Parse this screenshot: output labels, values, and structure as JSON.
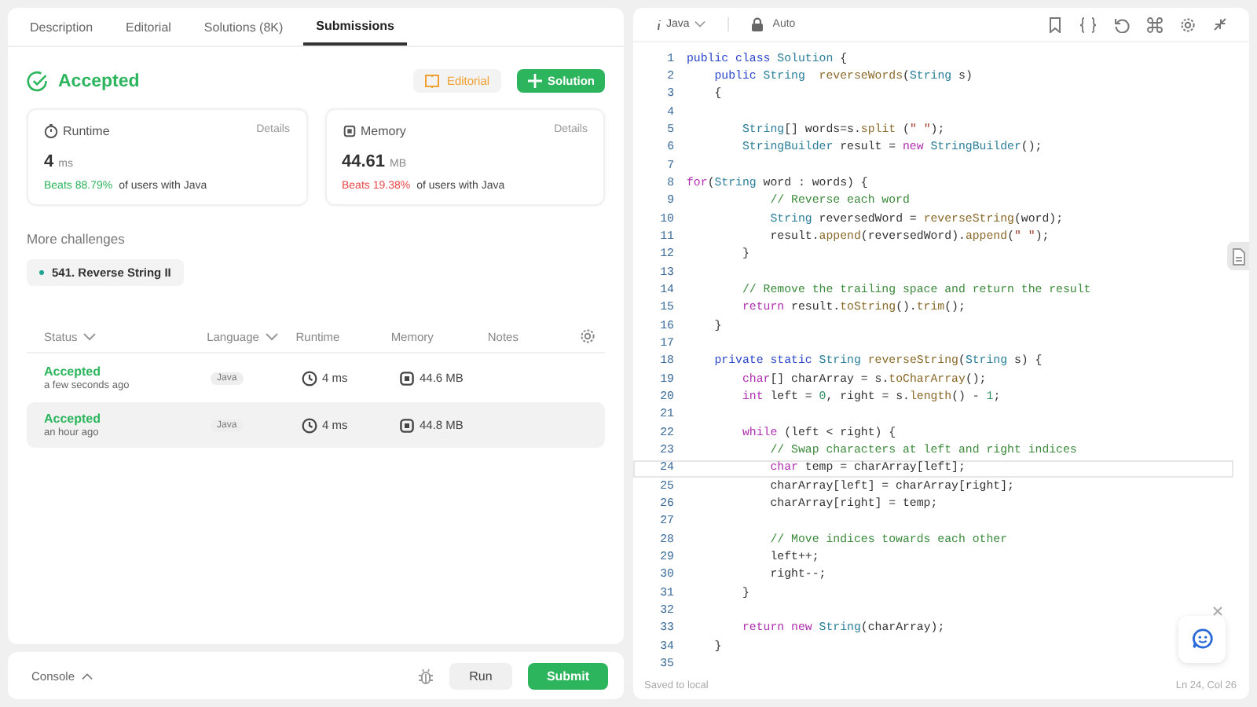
{
  "tabs": [
    {
      "label": "Description",
      "selected": false
    },
    {
      "label": "Editorial",
      "selected": false
    },
    {
      "label": "Solutions (8K)",
      "selected": false
    },
    {
      "label": "Submissions",
      "selected": true
    }
  ],
  "result": {
    "status": "Accepted",
    "editorial_button": "Editorial",
    "solution_button": "Solution"
  },
  "stats": [
    {
      "kind": "runtime",
      "title": "Runtime",
      "details": "Details",
      "value": "4",
      "unit": "ms",
      "beats": "Beats 88.79%",
      "beats_good": true,
      "suffix": "of users with Java"
    },
    {
      "kind": "memory",
      "title": "Memory",
      "details": "Details",
      "value": "44.61",
      "unit": "MB",
      "beats": "Beats 19.38%",
      "beats_good": false,
      "suffix": "of users with Java"
    }
  ],
  "more_challenges": {
    "title": "More challenges",
    "items": [
      {
        "label": "541. Reverse String II",
        "color": "#1fa392"
      }
    ]
  },
  "submissions": {
    "columns": [
      "Status",
      "Language",
      "Runtime",
      "Memory",
      "Notes"
    ],
    "rows": [
      {
        "status": "Accepted",
        "time": "a few seconds ago",
        "language": "Java",
        "runtime": "4 ms",
        "memory": "44.6 MB",
        "selected": false
      },
      {
        "status": "Accepted",
        "time": "an hour ago",
        "language": "Java",
        "runtime": "4 ms",
        "memory": "44.8 MB",
        "selected": true
      }
    ]
  },
  "console_bar": {
    "console": "Console",
    "run": "Run",
    "submit": "Submit"
  },
  "editor": {
    "language": "Java",
    "mode": "Auto",
    "lines": [
      {
        "number": "1",
        "current": false,
        "tokens": [
          {
            "kind": "kw",
            "text": "public class "
          },
          {
            "kind": "type",
            "text": "Solution"
          },
          {
            "kind": "pl",
            "text": " {"
          }
        ]
      },
      {
        "number": "2",
        "current": false,
        "tokens": [
          {
            "kind": "kw",
            "text": "    public "
          },
          {
            "kind": "type",
            "text": "String  "
          },
          {
            "kind": "fn",
            "text": "reverseWords"
          },
          {
            "kind": "pl",
            "text": "("
          },
          {
            "kind": "type",
            "text": "String"
          },
          {
            "kind": "pl",
            "text": " s)"
          }
        ]
      },
      {
        "number": "3",
        "current": false,
        "tokens": [
          {
            "kind": "pl",
            "text": "    {"
          }
        ]
      },
      {
        "number": "4",
        "current": false
      },
      {
        "number": "5",
        "current": false,
        "tokens": [
          {
            "kind": "type",
            "text": "        String"
          },
          {
            "kind": "pl",
            "text": "[] words=s."
          },
          {
            "kind": "fn",
            "text": "split"
          },
          {
            "kind": "pl",
            "text": " ("
          },
          {
            "kind": "str",
            "text": "\" \""
          },
          {
            "kind": "pl",
            "text": ");"
          }
        ]
      },
      {
        "number": "6",
        "current": false,
        "tokens": [
          {
            "kind": "type",
            "text": "        StringBuilder"
          },
          {
            "kind": "pl",
            "text": " result = "
          },
          {
            "kind": "ctl",
            "text": "new "
          },
          {
            "kind": "type",
            "text": "StringBuilder"
          },
          {
            "kind": "pl",
            "text": "();"
          }
        ]
      },
      {
        "number": "7",
        "current": false
      },
      {
        "number": "8",
        "current": false,
        "tokens": [
          {
            "kind": "ctl",
            "text": "for"
          },
          {
            "kind": "pl",
            "text": "("
          },
          {
            "kind": "type",
            "text": "String"
          },
          {
            "kind": "pl",
            "text": " word : words) {"
          }
        ]
      },
      {
        "number": "9",
        "current": false,
        "tokens": [
          {
            "kind": "cm",
            "text": "            // Reverse each word"
          }
        ]
      },
      {
        "number": "10",
        "current": false,
        "tokens": [
          {
            "kind": "type",
            "text": "            String"
          },
          {
            "kind": "pl",
            "text": " reversedWord = "
          },
          {
            "kind": "fn",
            "text": "reverseString"
          },
          {
            "kind": "pl",
            "text": "(word);"
          }
        ]
      },
      {
        "number": "11",
        "current": false,
        "tokens": [
          {
            "kind": "pl",
            "text": "            result."
          },
          {
            "kind": "fn",
            "text": "append"
          },
          {
            "kind": "pl",
            "text": "(reversedWord)."
          },
          {
            "kind": "fn",
            "text": "append"
          },
          {
            "kind": "pl",
            "text": "("
          },
          {
            "kind": "str",
            "text": "\" \""
          },
          {
            "kind": "pl",
            "text": ");"
          }
        ]
      },
      {
        "number": "12",
        "current": false,
        "tokens": [
          {
            "kind": "pl",
            "text": "        }"
          }
        ]
      },
      {
        "number": "13",
        "current": false
      },
      {
        "number": "14",
        "current": false,
        "tokens": [
          {
            "kind": "cm",
            "text": "        // Remove the trailing space and return the result"
          }
        ]
      },
      {
        "number": "15",
        "current": false,
        "tokens": [
          {
            "kind": "ctl",
            "text": "        return "
          },
          {
            "kind": "pl",
            "text": "result."
          },
          {
            "kind": "fn",
            "text": "toString"
          },
          {
            "kind": "pl",
            "text": "()."
          },
          {
            "kind": "fn",
            "text": "trim"
          },
          {
            "kind": "pl",
            "text": "();"
          }
        ]
      },
      {
        "number": "16",
        "current": false,
        "tokens": [
          {
            "kind": "pl",
            "text": "    }"
          }
        ]
      },
      {
        "number": "17",
        "current": false
      },
      {
        "number": "18",
        "current": false,
        "tokens": [
          {
            "kind": "kw",
            "text": "    private static "
          },
          {
            "kind": "type",
            "text": "String "
          },
          {
            "kind": "fn",
            "text": "reverseString"
          },
          {
            "kind": "pl",
            "text": "("
          },
          {
            "kind": "type",
            "text": "String"
          },
          {
            "kind": "pl",
            "text": " s) {"
          }
        ]
      },
      {
        "number": "19",
        "current": false,
        "tokens": [
          {
            "kind": "ctl",
            "text": "        char"
          },
          {
            "kind": "pl",
            "text": "[] charArray = s."
          },
          {
            "kind": "fn",
            "text": "toCharArray"
          },
          {
            "kind": "pl",
            "text": "();"
          }
        ]
      },
      {
        "number": "20",
        "current": false,
        "tokens": [
          {
            "kind": "ctl",
            "text": "        int"
          },
          {
            "kind": "pl",
            "text": " left = "
          },
          {
            "kind": "num",
            "text": "0"
          },
          {
            "kind": "pl",
            "text": ", right = s."
          },
          {
            "kind": "fn",
            "text": "length"
          },
          {
            "kind": "pl",
            "text": "() - "
          },
          {
            "kind": "num",
            "text": "1"
          },
          {
            "kind": "pl",
            "text": ";"
          }
        ]
      },
      {
        "number": "21",
        "current": false
      },
      {
        "number": "22",
        "current": false,
        "tokens": [
          {
            "kind": "ctl",
            "text": "        while"
          },
          {
            "kind": "pl",
            "text": " (left < right) {"
          }
        ]
      },
      {
        "number": "23",
        "current": false,
        "tokens": [
          {
            "kind": "cm",
            "text": "            // Swap characters at left and right indices"
          }
        ]
      },
      {
        "number": "24",
        "current": true,
        "tokens": [
          {
            "kind": "ctl",
            "text": "            char"
          },
          {
            "kind": "pl",
            "text": " temp = charArray[left];"
          }
        ]
      },
      {
        "number": "25",
        "current": false,
        "tokens": [
          {
            "kind": "pl",
            "text": "            charArray[left] = charArray[right];"
          }
        ]
      },
      {
        "number": "26",
        "current": false,
        "tokens": [
          {
            "kind": "pl",
            "text": "            charArray[right] = temp;"
          }
        ]
      },
      {
        "number": "27",
        "current": false
      },
      {
        "number": "28",
        "current": false,
        "tokens": [
          {
            "kind": "cm",
            "text": "            // Move indices towards each other"
          }
        ]
      },
      {
        "number": "29",
        "current": false,
        "tokens": [
          {
            "kind": "pl",
            "text": "            left++;"
          }
        ]
      },
      {
        "number": "30",
        "current": false,
        "tokens": [
          {
            "kind": "pl",
            "text": "            right--;"
          }
        ]
      },
      {
        "number": "31",
        "current": false,
        "tokens": [
          {
            "kind": "pl",
            "text": "        }"
          }
        ]
      },
      {
        "number": "32",
        "current": false
      },
      {
        "number": "33",
        "current": false,
        "tokens": [
          {
            "kind": "ctl",
            "text": "        return new "
          },
          {
            "kind": "type",
            "text": "String"
          },
          {
            "kind": "pl",
            "text": "(charArray);"
          }
        ]
      },
      {
        "number": "34",
        "current": false,
        "tokens": [
          {
            "kind": "pl",
            "text": "    }"
          }
        ]
      },
      {
        "number": "35",
        "current": false
      }
    ],
    "saved": "Saved to local",
    "cursor": "Ln 24, Col 26"
  }
}
